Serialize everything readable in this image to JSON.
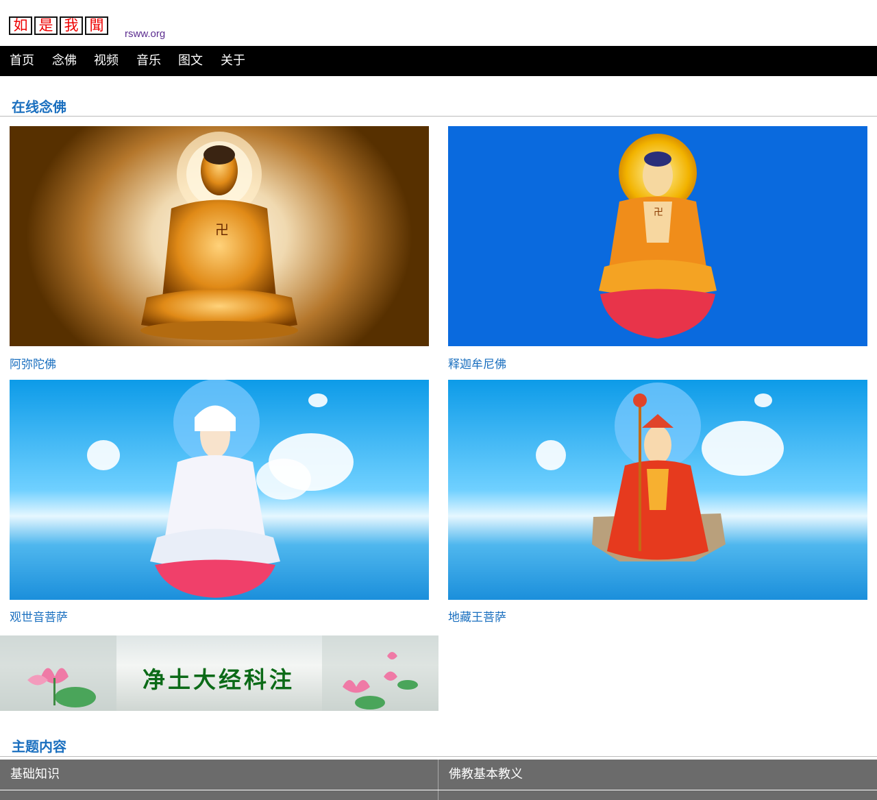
{
  "site": {
    "logo_chars": [
      "如",
      "是",
      "我",
      "聞"
    ],
    "domain": "rsww.org"
  },
  "nav": {
    "items": [
      "首页",
      "念佛",
      "视频",
      "音乐",
      "图文",
      "关于"
    ]
  },
  "online_recitation": {
    "title": "在线念佛",
    "cards": [
      {
        "label": "阿弥陀佛"
      },
      {
        "label": "释迦牟尼佛"
      },
      {
        "label": "观世音菩萨"
      },
      {
        "label": "地藏王菩萨"
      }
    ]
  },
  "banner": {
    "text": "净土大经科注"
  },
  "topics": {
    "title": "主题内容",
    "rows": [
      [
        "基础知识",
        "佛教基本教义"
      ]
    ]
  },
  "colors": {
    "accent": "#1a6fbf",
    "nav_bg": "#000000",
    "table_bg": "#6b6b6b"
  }
}
